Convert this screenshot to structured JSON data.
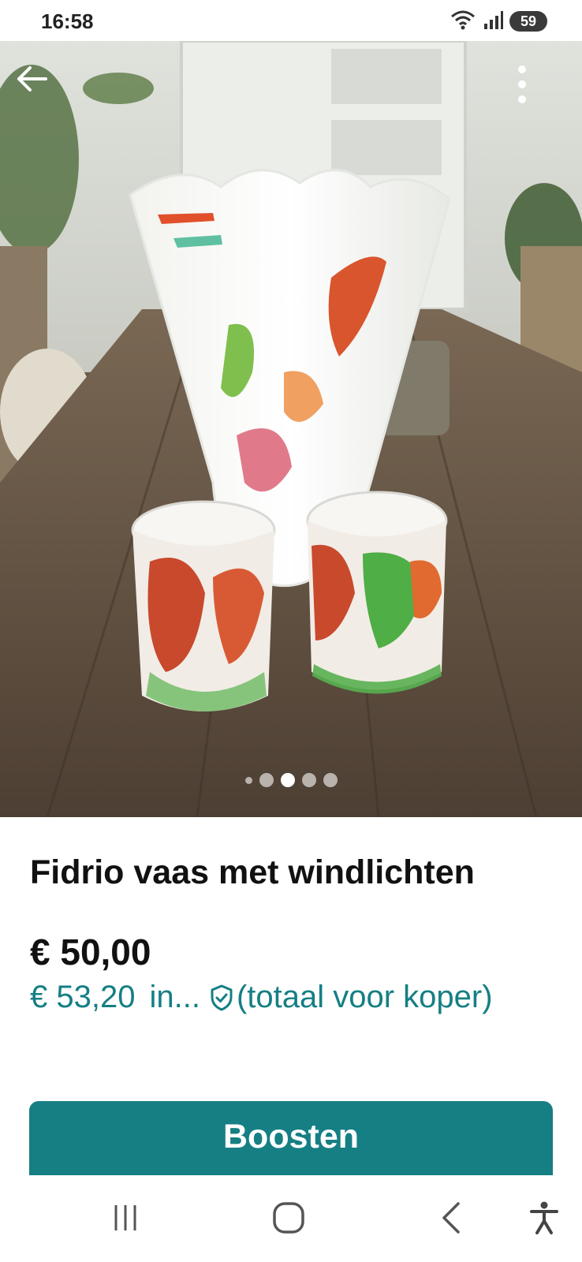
{
  "status_bar": {
    "time": "16:58",
    "battery": "59",
    "wifi_badge": "5"
  },
  "photo": {
    "icons": {
      "back": "arrow-left-icon",
      "more": "more-vertical-icon"
    },
    "carousel": {
      "count": 5,
      "active_index": 2
    }
  },
  "listing": {
    "title": "Fidrio vaas met windlichten",
    "price": "€ 50,00",
    "total_price": "€ 53,20",
    "total_suffix_short": "in...",
    "total_note": "(totaal voor koper)"
  },
  "actions": {
    "boost_label": "Boosten"
  },
  "nav": {
    "icons": [
      "recent-apps-icon",
      "home-icon",
      "back-icon",
      "accessibility-icon"
    ]
  },
  "colors": {
    "accent": "#157f84",
    "text": "#111111"
  }
}
